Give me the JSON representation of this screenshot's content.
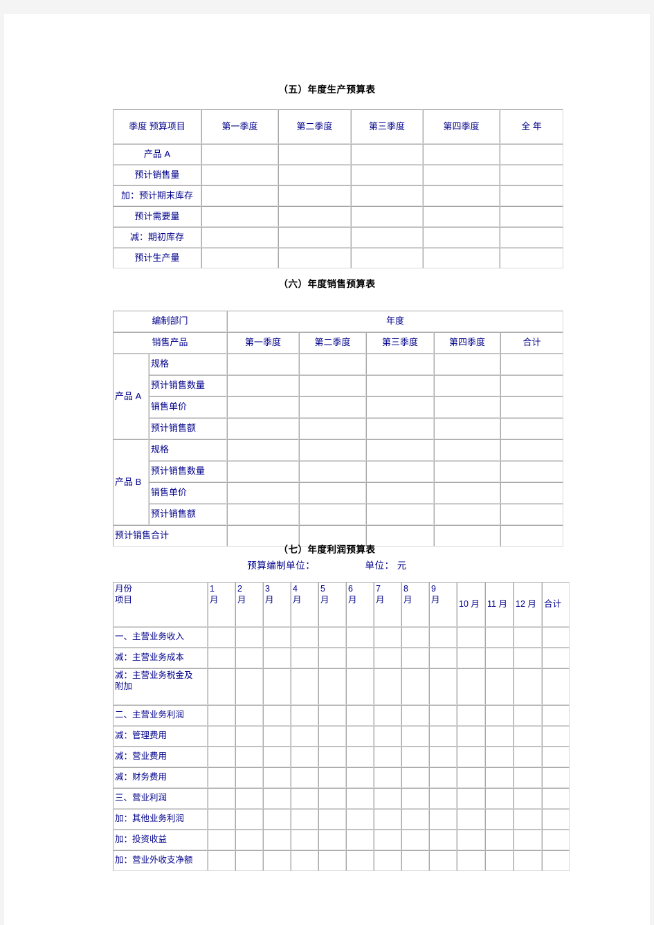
{
  "document": {
    "colors": {
      "text_blue": "#00008b",
      "title_black": "#000000",
      "border_gray": "#a6a6a6",
      "page_background": "#ffffff",
      "canvas_background": "#f4f4f4"
    }
  },
  "section5": {
    "title": "（五）年度生产预算表",
    "header_corner": "季度\n预算项目",
    "columns": [
      "第一季度",
      "第二季度",
      "第三季度",
      "第四季度",
      "全 年"
    ],
    "rows": [
      "产品 A",
      "预计销售量",
      "加：预计期末库存",
      "预计需要量",
      "减：期初库存",
      "预计生产量"
    ]
  },
  "section6": {
    "title": "（六）年度销售预算表",
    "header_department": "编制部门",
    "header_year": "年度",
    "header_product": "销售产品",
    "columns": [
      "第一季度",
      "第二季度",
      "第三季度",
      "第四季度",
      "合计"
    ],
    "product_a_label": "产品 A",
    "product_b_label": "产品 B",
    "sub_rows": [
      "规格",
      "预计销售数量",
      "销售单价",
      "预计销售额"
    ],
    "total_row": "预计销售合计"
  },
  "section7": {
    "title": "（七）年度利润预算表",
    "subtitle_left": "预算编制单位：",
    "subtitle_right": "单位： 元",
    "subtitle_full": "预算编制单位：                 单位： 元",
    "header_corner_top": "月份",
    "header_corner_bottom": "项目",
    "month_numbers": [
      "1",
      "2",
      "3",
      "4",
      "5",
      "6",
      "7",
      "8",
      "9"
    ],
    "month_suffix": "月",
    "late_months": [
      "10 月",
      "11 月",
      "12 月"
    ],
    "total_column": "合计",
    "rows": [
      "一、主营业务收入",
      "减：主营业务成本",
      "减：主营业务税金及\n附加",
      "二、主营业务利润",
      "减：管理费用",
      "减：营业费用",
      "减：财务费用",
      "三、营业利润",
      "加：其他业务利润",
      "加：投资收益",
      "加：营业外收支净额"
    ]
  }
}
